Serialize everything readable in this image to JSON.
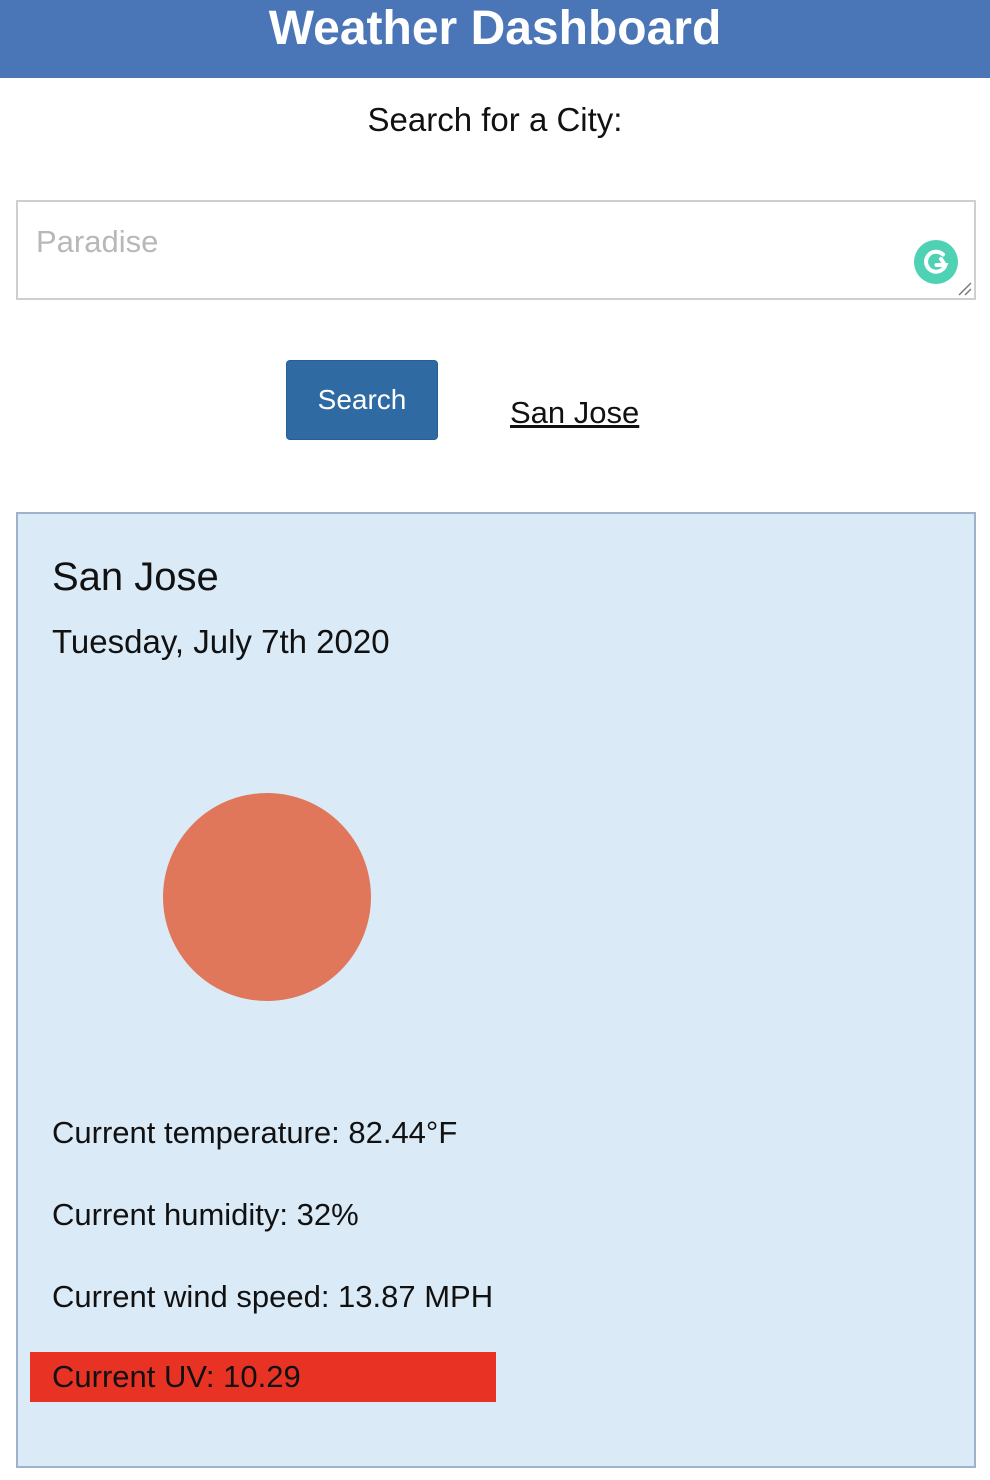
{
  "header": {
    "title": "Weather Dashboard",
    "background_color": "#4a76b8"
  },
  "search": {
    "heading": "Search for a City:",
    "placeholder": "Paradise",
    "value": "",
    "button_label": "Search",
    "grammarly_icon": "grammarly-g-icon"
  },
  "history": {
    "items": [
      "San Jose"
    ]
  },
  "current_weather": {
    "city": "San Jose",
    "date": "Tuesday, July 7th 2020",
    "icon": "sun-icon",
    "icon_color": "#e0765a",
    "temperature": "Current temperature: 82.44°F",
    "humidity": "Current humidity: 32%",
    "wind_speed": "Current wind speed: 13.87 MPH",
    "uv": "Current UV: 10.29",
    "uv_color": "#e83324",
    "card_color": "#daeaf7"
  }
}
